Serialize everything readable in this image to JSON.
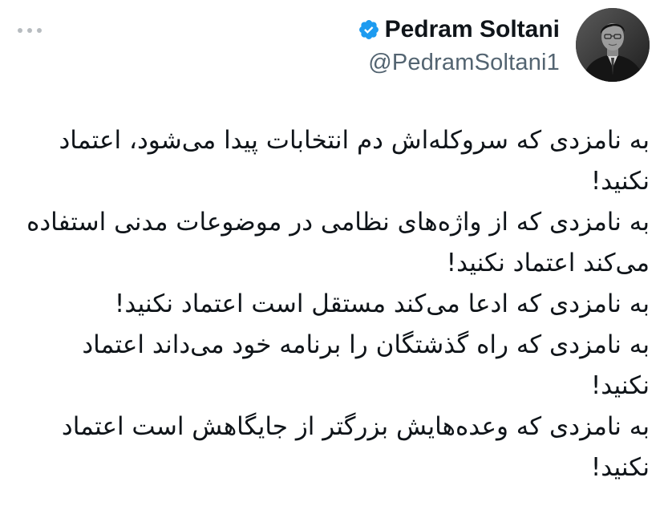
{
  "author": {
    "display_name": "Pedram Soltani",
    "handle": "@PedramSoltani1",
    "verified": true,
    "verified_color": "#1d9bf0"
  },
  "icons": {
    "more": "more-horizontal-icon",
    "verified": "verified-badge-icon"
  },
  "tweet": {
    "paragraphs": [
      "به نامزدی که سروکله‌اش دم انتخابات پیدا می‌شود، اعتماد نکنید!",
      "به نامزدی که از واژه‌های نظامی در موضوعات مدنی استفاده می‌کند اعتماد نکنید!",
      "به نامزدی که ادعا می‌کند مستقل است اعتماد نکنید!",
      "به نامزدی که راه گذشتگان را برنامه خود می‌داند اعتماد نکنید!",
      "به نامزدی که وعده‌هایش بزرگتر از جایگاهش است اعتماد نکنید!"
    ]
  }
}
